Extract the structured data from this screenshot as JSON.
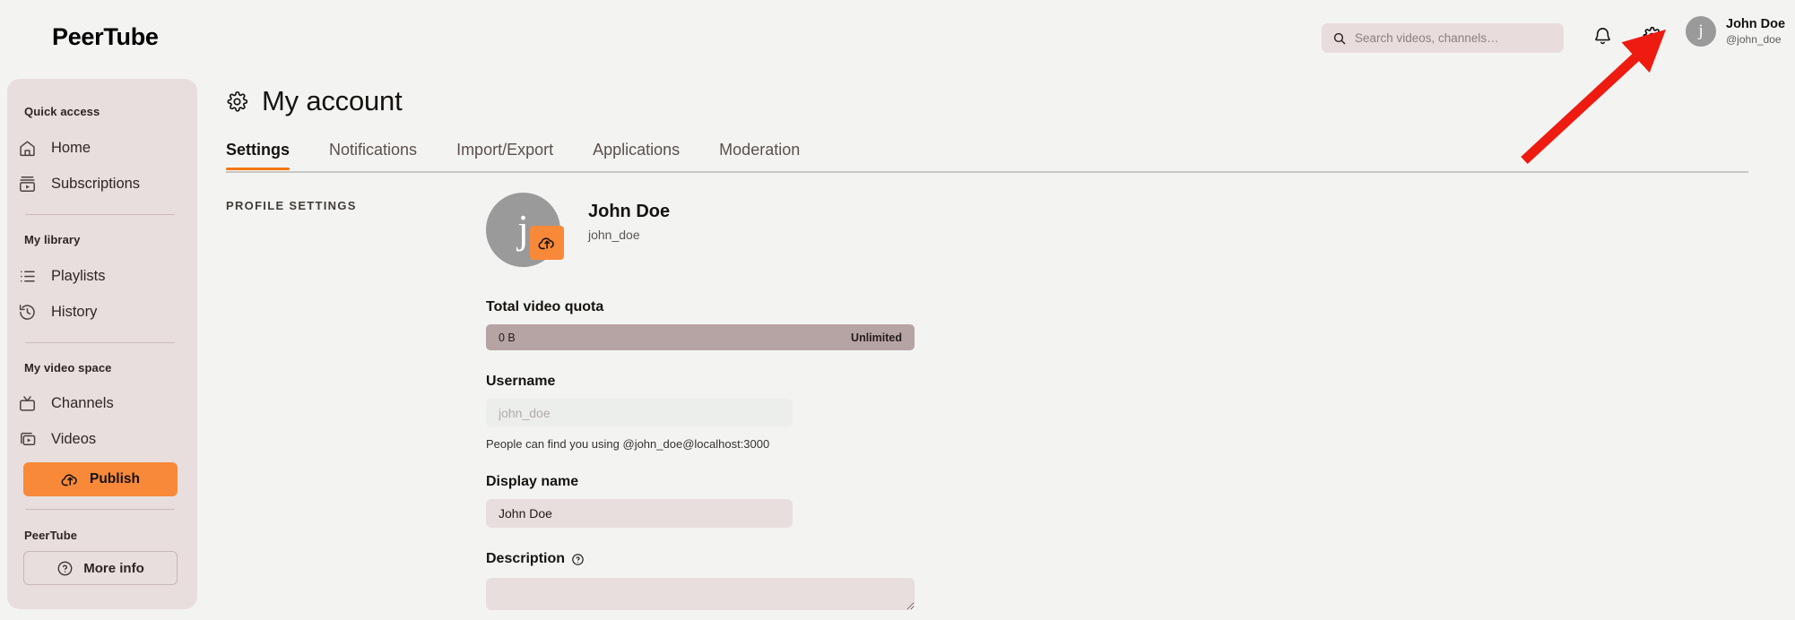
{
  "header": {
    "brand": "PeerTube",
    "search": {
      "placeholder": "Search videos, channels…",
      "icon": "search-icon"
    },
    "notifications_icon": "bell-icon",
    "settings_icon": "gear-icon",
    "user": {
      "avatar_letter": "j",
      "name": "John Doe",
      "handle": "@john_doe"
    }
  },
  "sidebar": {
    "collapse_icon": "chevron-left-icon",
    "sections": [
      {
        "title": "Quick access"
      },
      {
        "title": "My library"
      },
      {
        "title": "My video space"
      },
      {
        "title": "PeerTube"
      }
    ],
    "items": [
      {
        "label": "Home",
        "icon": "home-icon"
      },
      {
        "label": "Subscriptions",
        "icon": "subscriptions-icon"
      },
      {
        "label": "Playlists",
        "icon": "playlist-icon"
      },
      {
        "label": "History",
        "icon": "history-icon"
      },
      {
        "label": "Channels",
        "icon": "tv-icon"
      },
      {
        "label": "Videos",
        "icon": "videos-icon"
      }
    ],
    "publish_label": "Publish",
    "publish_icon": "upload-cloud-icon",
    "more_info_label": "More info",
    "more_info_icon": "question-circle-icon"
  },
  "main": {
    "page_title": "My account",
    "page_title_icon": "gear-icon",
    "tabs": [
      {
        "label": "Settings",
        "active": true
      },
      {
        "label": "Notifications",
        "active": false
      },
      {
        "label": "Import/Export",
        "active": false
      },
      {
        "label": "Applications",
        "active": false
      },
      {
        "label": "Moderation",
        "active": false
      }
    ],
    "section_label": "PROFILE SETTINGS",
    "profile": {
      "avatar_letter": "j",
      "avatar_upload_icon": "upload-cloud-icon",
      "display_name": "John Doe",
      "username": "john_doe"
    },
    "quota": {
      "label": "Total video quota",
      "used": "0 B",
      "max": "Unlimited"
    },
    "username_field": {
      "label": "Username",
      "placeholder": "john_doe",
      "value": "",
      "help": "People can find you using @john_doe@localhost:3000"
    },
    "display_name_field": {
      "label": "Display name",
      "value": "John Doe"
    },
    "description_field": {
      "label": "Description",
      "help_icon": "question-circle-icon",
      "value": ""
    }
  },
  "annotation": {
    "arrow_color": "#ee1b11"
  },
  "colors": {
    "accent_orange": "#f78939",
    "tab_underline": "#f2760c",
    "sidebar_bg": "#e8dedd",
    "page_bg": "#f3f4f2",
    "quota_bar": "#b6a3a3"
  }
}
